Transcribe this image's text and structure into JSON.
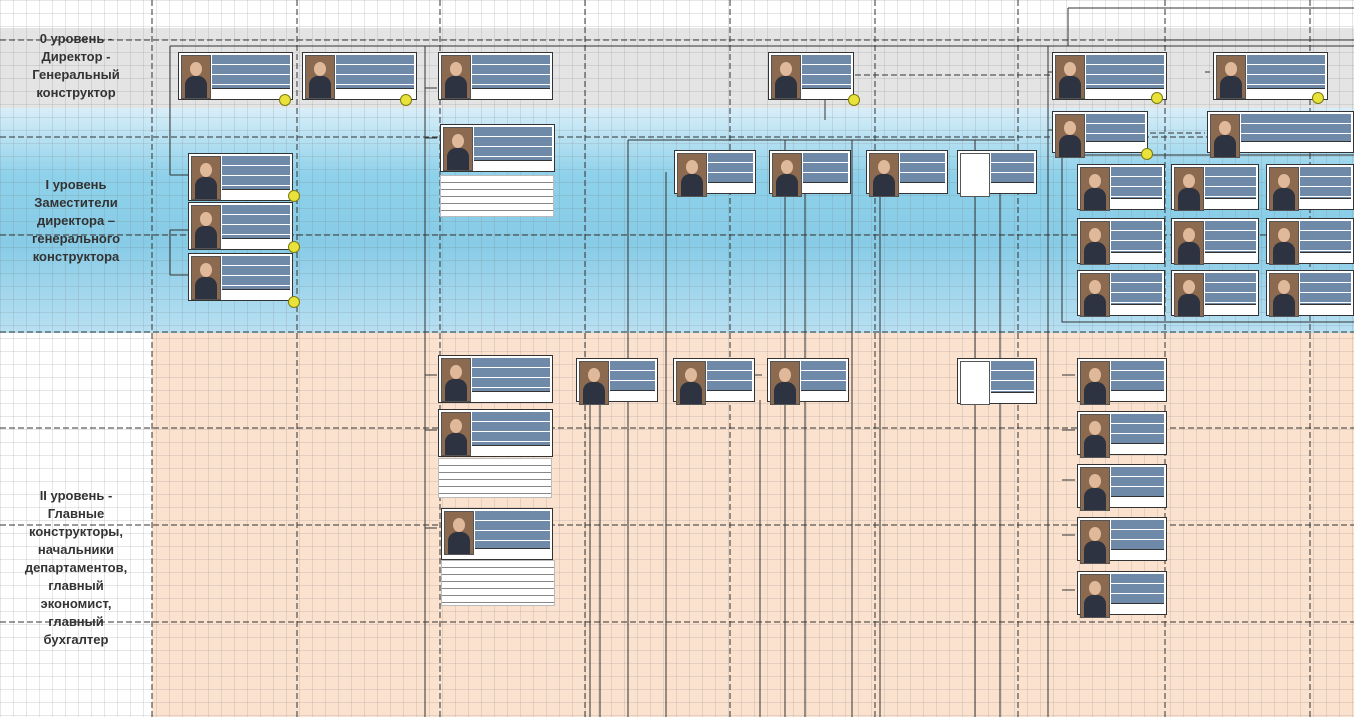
{
  "levels": [
    {
      "label": "0 уровень -\nДиректор -\nГенеральный\nконструктор"
    },
    {
      "label": "I уровень\nЗаместители\nдиректора –\nгенерального\nконструктора"
    },
    {
      "label": "II уровень -\nГлавные\nконструкторы,\nначальники\nдепартаментов,\nглавный\nэкономист,\nглавный\nбухгалтер"
    }
  ],
  "colors": {
    "level0": "#e4e4e4",
    "level1": "#8ed1ea",
    "level2": "#fbe2cf",
    "card_header": "#6f8aa9",
    "connector_knob": "#e9e23a"
  },
  "cards": [
    {
      "id": "L0-1",
      "photo": true
    },
    {
      "id": "L0-2",
      "photo": true
    },
    {
      "id": "L0-3",
      "photo": true
    },
    {
      "id": "L0-4",
      "photo": true
    },
    {
      "id": "L0-5",
      "photo": true
    },
    {
      "id": "L0-6",
      "photo": true
    },
    {
      "id": "L1-a1",
      "photo": true
    },
    {
      "id": "L1-a2",
      "photo": true
    },
    {
      "id": "L1-a3",
      "photo": true
    },
    {
      "id": "L1-b",
      "photo": true
    },
    {
      "id": "L1-c1",
      "photo": true
    },
    {
      "id": "L1-c2",
      "photo": true
    },
    {
      "id": "L1-c3",
      "photo": true
    },
    {
      "id": "L1-c4",
      "photo": false
    },
    {
      "id": "L1-d1",
      "photo": true
    },
    {
      "id": "L1-d2",
      "photo": true
    },
    {
      "id": "L1-g1",
      "photo": true
    },
    {
      "id": "L1-g2",
      "photo": true
    },
    {
      "id": "L1-g3",
      "photo": true
    },
    {
      "id": "L1-g4",
      "photo": true
    },
    {
      "id": "L1-g5",
      "photo": true
    },
    {
      "id": "L1-g6",
      "photo": true
    },
    {
      "id": "L1-g7",
      "photo": true
    },
    {
      "id": "L1-g8",
      "photo": true
    },
    {
      "id": "L1-g9",
      "photo": true
    },
    {
      "id": "L2-1",
      "photo": true
    },
    {
      "id": "L2-2",
      "photo": true
    },
    {
      "id": "L2-3",
      "photo": true
    },
    {
      "id": "L2-4",
      "photo": true
    },
    {
      "id": "L2-5",
      "photo": true
    },
    {
      "id": "L2-6",
      "photo": true
    },
    {
      "id": "L2-7",
      "photo": false
    },
    {
      "id": "L2-r1",
      "photo": true
    },
    {
      "id": "L2-r2",
      "photo": true
    },
    {
      "id": "L2-r3",
      "photo": true
    },
    {
      "id": "L2-r4",
      "photo": true
    },
    {
      "id": "L2-r5",
      "photo": true
    }
  ]
}
